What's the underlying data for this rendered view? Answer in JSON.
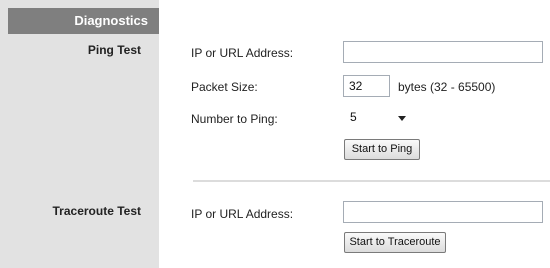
{
  "sidebar": {
    "title": "Diagnostics"
  },
  "ping_test": {
    "section_label": "Ping Test",
    "address_label": "IP or URL Address:",
    "address_value": "",
    "packet_size_label": "Packet Size:",
    "packet_size_value": "32",
    "packet_size_unit": "bytes (32 - 65500)",
    "number_label": "Number to Ping:",
    "number_value": "5",
    "start_button": "Start to Ping"
  },
  "traceroute_test": {
    "section_label": "Traceroute Test",
    "address_label": "IP or URL Address:",
    "address_value": "",
    "start_button": "Start to Traceroute"
  }
}
